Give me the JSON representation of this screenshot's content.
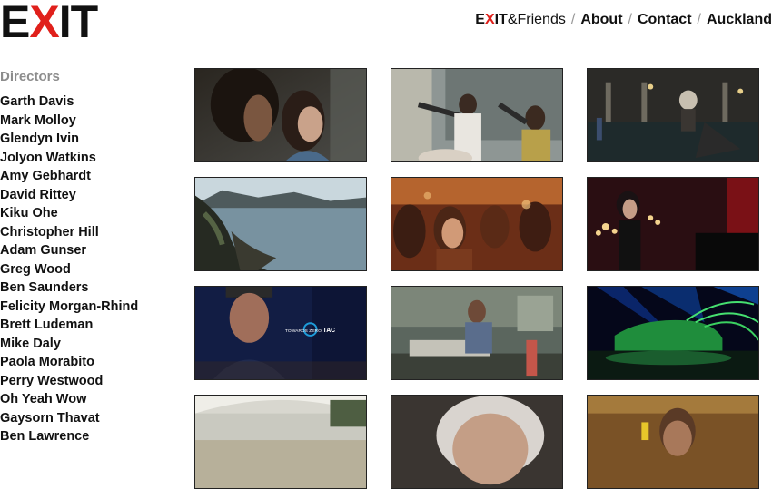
{
  "brand": {
    "logo_prefix": "E",
    "logo_x": "X",
    "logo_suffix": "IT"
  },
  "nav": {
    "friends": {
      "prefix": "E",
      "x": "X",
      "suffix": "IT",
      "rest": "&Friends"
    },
    "separator": "/",
    "about": "About",
    "contact": "Contact",
    "auckland": "Auckland"
  },
  "sidebar": {
    "heading": "Directors",
    "directors": [
      "Garth Davis",
      "Mark Molloy",
      "Glendyn Ivin",
      "Jolyon Watkins",
      "Amy Gebhardt",
      "David Rittey",
      "Kiku Ohe",
      "Christopher Hill",
      "Adam Gunser",
      "Greg Wood",
      "Ben Saunders",
      "Felicity Morgan-Rhind",
      "Brett Ludeman",
      "Mike Daly",
      "Paola Morabito",
      "Perry Westwood",
      "Oh Yeah Wow",
      "Gaysorn Thavat",
      "Ben Lawrence"
    ]
  },
  "grid": {
    "tiles": [
      {
        "icon": "film-still-couple-night"
      },
      {
        "icon": "film-still-classroom"
      },
      {
        "icon": "film-still-plaza-night"
      },
      {
        "icon": "film-still-coastline"
      },
      {
        "icon": "film-still-crowd-party"
      },
      {
        "icon": "film-still-singer-piano"
      },
      {
        "icon": "film-still-police-officer"
      },
      {
        "icon": "film-still-office-worker"
      },
      {
        "icon": "film-still-green-car-lasers"
      },
      {
        "icon": "film-still-beach-promenade"
      },
      {
        "icon": "film-still-elderly-woman"
      },
      {
        "icon": "film-still-man-phone"
      }
    ],
    "tac_text": "TOWARDS ZERO",
    "tac_logo": "TAC"
  },
  "colors": {
    "brand_red": "#e0201b",
    "text": "#111111",
    "muted": "#8c8c8c"
  }
}
